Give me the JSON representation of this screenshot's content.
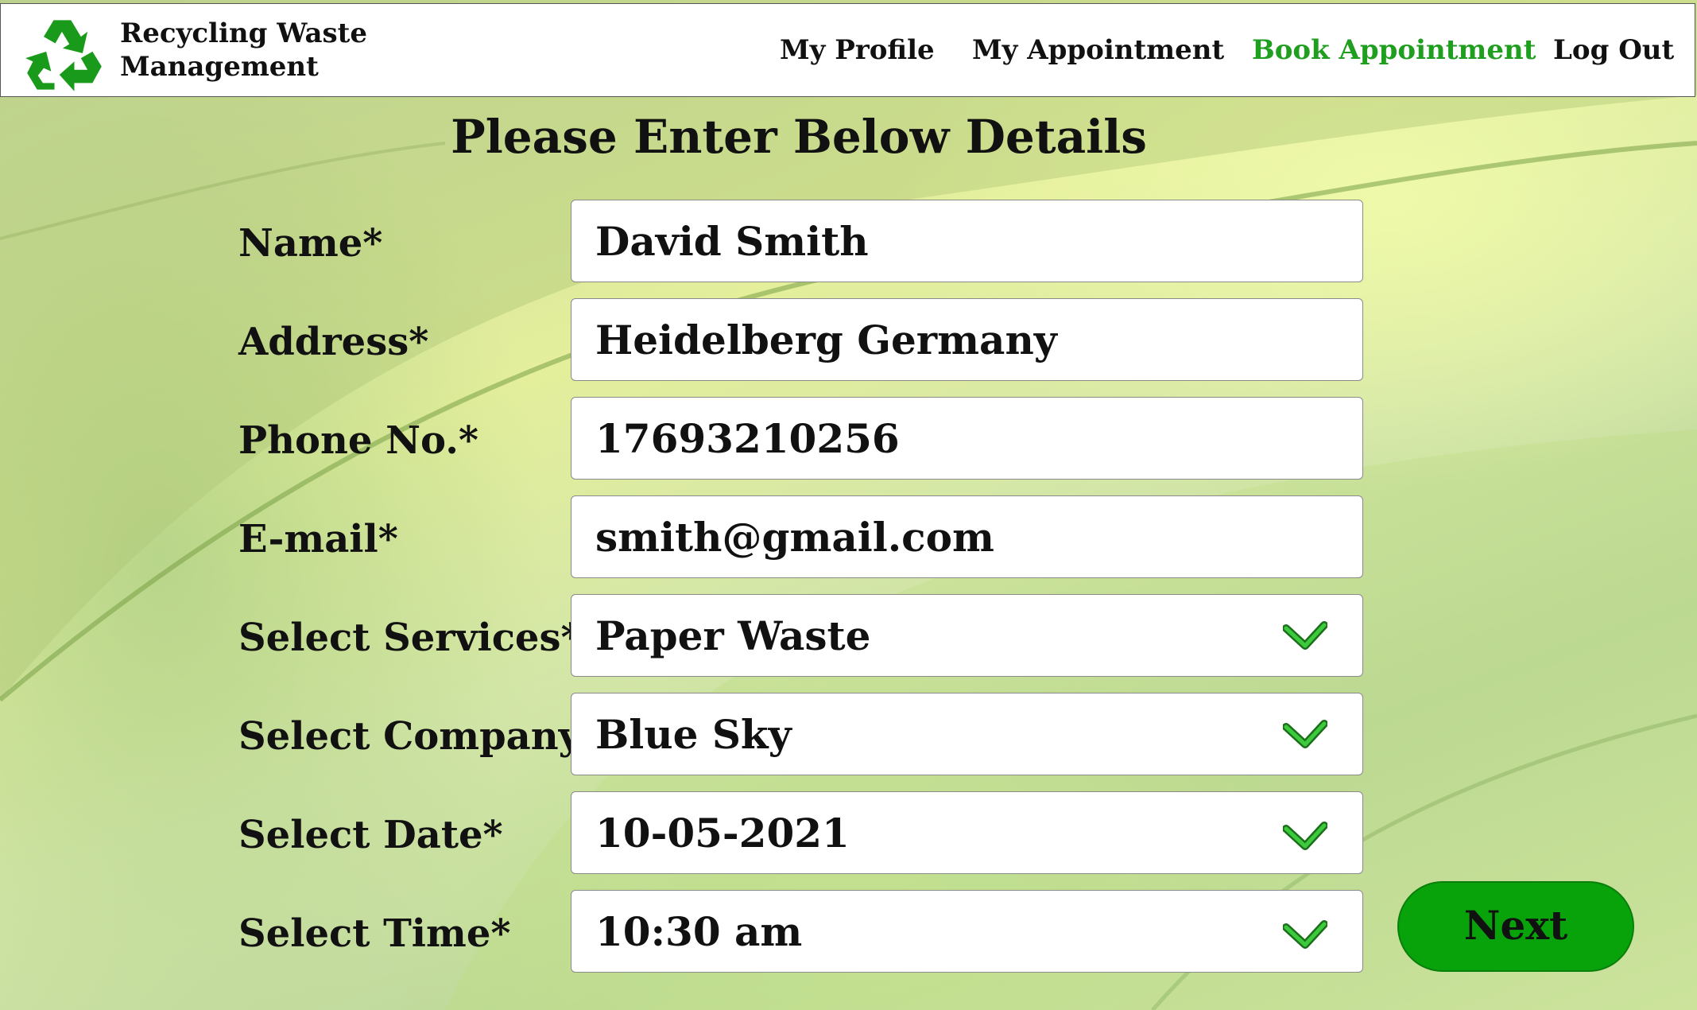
{
  "app": {
    "brand_line1": "Recycling Waste",
    "brand_line2": "Management"
  },
  "nav": {
    "items": [
      {
        "label": "My Profile",
        "active": false
      },
      {
        "label": "My Appointment",
        "active": false
      },
      {
        "label": "Book Appointment",
        "active": true
      },
      {
        "label": "Log Out",
        "active": false
      }
    ]
  },
  "form": {
    "title": "Please Enter Below Details",
    "fields": [
      {
        "label": "Name*",
        "value": "David Smith",
        "type": "text"
      },
      {
        "label": "Address*",
        "value": "Heidelberg Germany",
        "type": "text"
      },
      {
        "label": "Phone No.*",
        "value": "17693210256",
        "type": "text"
      },
      {
        "label": "E-mail*",
        "value": "smith@gmail.com",
        "type": "text"
      },
      {
        "label": "Select Services*",
        "value": "Paper Waste",
        "type": "select"
      },
      {
        "label": "Select Company*",
        "value": "Blue Sky",
        "type": "select"
      },
      {
        "label": "Select Date*",
        "value": "10-05-2021",
        "type": "select"
      },
      {
        "label": "Select Time*",
        "value": "10:30 am",
        "type": "select"
      }
    ],
    "next_label": "Next"
  },
  "colors": {
    "accent_green": "#1f9e1f",
    "button_green": "#08a20a",
    "logo_green": "#1a9a1a",
    "chevron_green": "#3cc93c"
  },
  "icons": {
    "logo": "recycle-icon",
    "dropdown": "chevron-down-icon"
  }
}
